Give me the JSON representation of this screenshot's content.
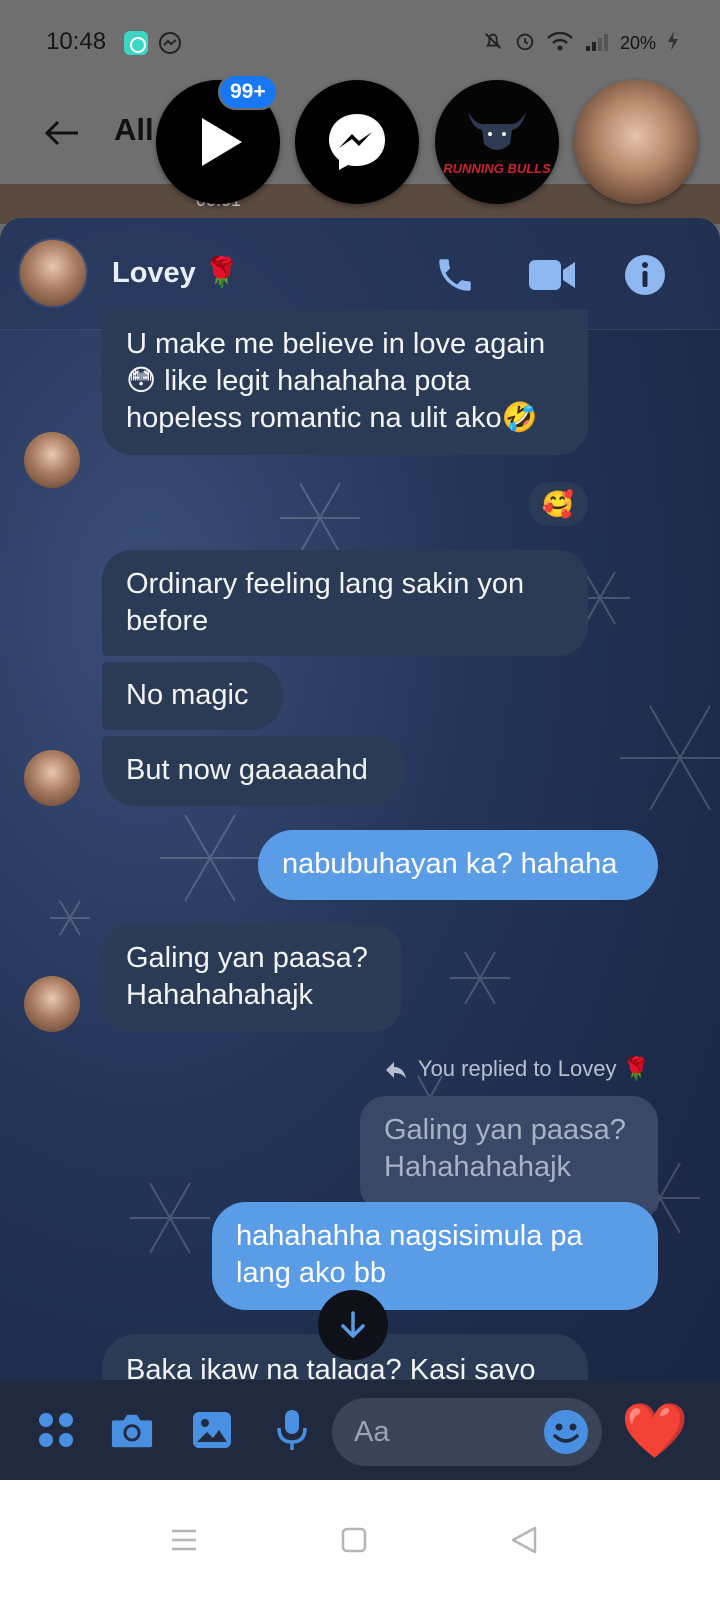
{
  "status_bar": {
    "time": "10:48",
    "battery": "20%"
  },
  "background_app": {
    "filter_label": "All",
    "thumb_time": "00:01"
  },
  "chat_heads": {
    "badge": "99+",
    "bull_text": "RUNNING BULLS"
  },
  "conversation": {
    "contact_name": "Lovey 🌹",
    "messages": [
      {
        "text": "U make me believe in love again 😳 like legit hahahaha pota hopeless romantic na ulit ako🤣"
      },
      {
        "text": "🥰"
      },
      {
        "text": "Ordinary feeling lang sakin yon before"
      },
      {
        "text": "No magic"
      },
      {
        "text": "But now gaaaaahd"
      },
      {
        "text": "nabubuhayan ka? hahaha"
      },
      {
        "text": "Galing yan paasa? Hahahahahajk"
      },
      {
        "text": "You replied to Lovey 🌹"
      },
      {
        "text": "Galing yan paasa? Hahahahahajk"
      },
      {
        "text": "hahahahha nagsisimula pa lang ako bb"
      },
      {
        "text": "Baka ikaw na talaga? Kasi sayo"
      }
    ]
  },
  "composer": {
    "placeholder": "Aa",
    "like_emoji": "❤️"
  },
  "colors": {
    "outgoing": "#5a9ce6",
    "incoming": "#2b3a55",
    "accent": "#4a90e2"
  }
}
